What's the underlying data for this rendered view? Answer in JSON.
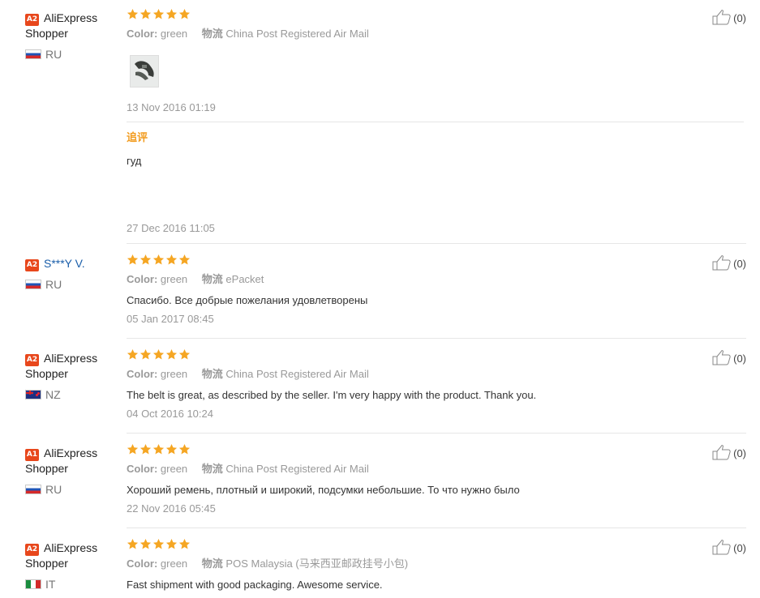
{
  "reviews": [
    {
      "level": "A2",
      "name_line1": "AliExpress",
      "name_line2": "Shopper",
      "country": "RU",
      "rating": 5,
      "color_label": "Color:",
      "color_value": "green",
      "shipping_label": "物流",
      "shipping_value": "China Post Registered Air Mail",
      "has_photo": true,
      "feedback": "",
      "date": "13 Nov 2016 01:19",
      "followup": {
        "label": "追评",
        "text": "гуд",
        "date": "27 Dec 2016 11:05"
      },
      "helpful_count": "(0)"
    },
    {
      "level": "A2",
      "name_line1": "S***Y V.",
      "name_line2": "",
      "country": "RU",
      "rating": 5,
      "color_label": "Color:",
      "color_value": "green",
      "shipping_label": "物流",
      "shipping_value": "ePacket",
      "feedback": "Спасибо. Все добрые пожелания удовлетворены",
      "date": "05 Jan 2017 08:45",
      "helpful_count": "(0)"
    },
    {
      "level": "A2",
      "name_line1": "AliExpress",
      "name_line2": "Shopper",
      "country": "NZ",
      "rating": 5,
      "color_label": "Color:",
      "color_value": "green",
      "shipping_label": "物流",
      "shipping_value": "China Post Registered Air Mail",
      "feedback": "The belt is great, as described by the seller. I'm very happy with the product. Thank you.",
      "date": "04 Oct 2016 10:24",
      "helpful_count": "(0)"
    },
    {
      "level": "A1",
      "name_line1": "AliExpress",
      "name_line2": "Shopper",
      "country": "RU",
      "rating": 5,
      "color_label": "Color:",
      "color_value": "green",
      "shipping_label": "物流",
      "shipping_value": "China Post Registered Air Mail",
      "feedback": "Хороший ремень, плотный и широкий, подсумки небольшие. То что нужно было",
      "date": "22 Nov 2016 05:45",
      "helpful_count": "(0)"
    },
    {
      "level": "A2",
      "name_line1": "AliExpress",
      "name_line2": "Shopper",
      "country": "IT",
      "rating": 5,
      "color_label": "Color:",
      "color_value": "green",
      "shipping_label": "物流",
      "shipping_value": "POS Malaysia (马来西亚邮政挂号小包)",
      "feedback": "Fast shipment with good packaging. Awesome service.",
      "date": "",
      "helpful_count": "(0)"
    }
  ],
  "colors": {
    "star": "#f5a623",
    "level_badge": "#e8471c",
    "followup_label": "#f29b1d",
    "link": "#1a5eaa"
  },
  "icons": {
    "rating": "star-icon",
    "helpful": "thumbs-up-icon"
  }
}
